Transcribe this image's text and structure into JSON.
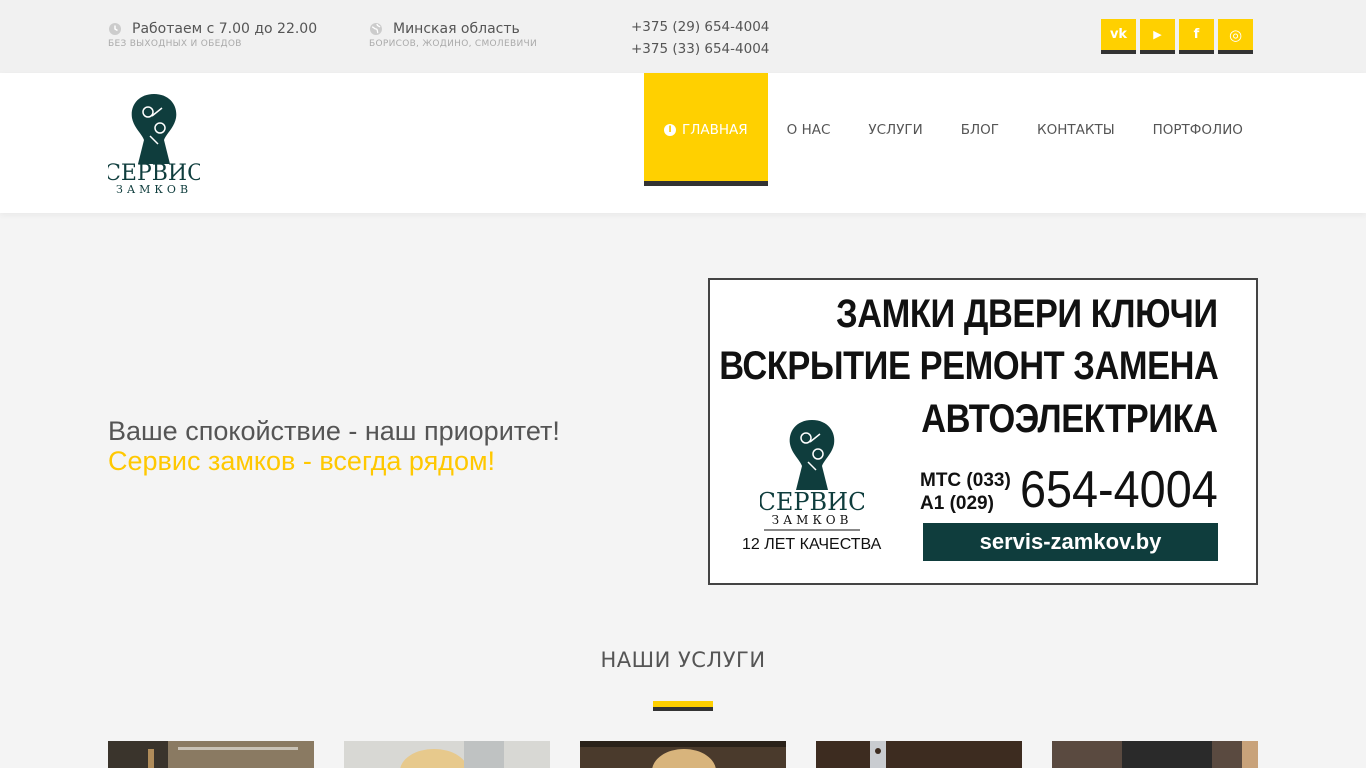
{
  "topbar": {
    "hours": {
      "main": "Работаем с 7.00 до 22.00",
      "sub": "БЕЗ ВЫХОДНЫХ И ОБЕДОВ",
      "icon": "clock-icon"
    },
    "region": {
      "main": "Минская область",
      "sub": "БОРИСОВ, ЖОДИНО, СМОЛЕВИЧИ",
      "icon": "globe-icon"
    },
    "phones": [
      "+375 (29) 654-4004",
      "+375 (33) 654-4004"
    ],
    "social": [
      {
        "name": "vk-icon",
        "glyph": "vk"
      },
      {
        "name": "youtube-icon",
        "glyph": "▶"
      },
      {
        "name": "facebook-icon",
        "glyph": "f"
      },
      {
        "name": "instagram-icon",
        "glyph": "◎"
      }
    ]
  },
  "header": {
    "logo": {
      "line1": "СЕРВИС",
      "line2": "ЗАМКОВ"
    },
    "nav": [
      {
        "label": "ГЛАВНАЯ",
        "active": true
      },
      {
        "label": "О НАС"
      },
      {
        "label": "УСЛУГИ"
      },
      {
        "label": "БЛОГ"
      },
      {
        "label": "КОНТАКТЫ"
      },
      {
        "label": "ПОРТФОЛИО"
      }
    ]
  },
  "hero": {
    "line1": "Ваше спокойствие - наш приоритет!",
    "line2": "Сервис замков - всегда рядом!"
  },
  "banner": {
    "l1": "ЗАМКИ ДВЕРИ КЛЮЧИ",
    "l2": "ВСКРЫТИЕ РЕМОНТ ЗАМЕНА",
    "l3": "АВТОЭЛЕКТРИКА",
    "op1": "МТС (033)",
    "op2": "А1  (029)",
    "number": "654-4004",
    "site": "servis-zamkov.by",
    "years": "12 ЛЕТ КАЧЕСТВА",
    "logo1": "СЕРВИС",
    "logo2": "ЗАМКОВ"
  },
  "services": {
    "title": "НАШИ УСЛУГИ"
  },
  "colors": {
    "accent": "#ffd000",
    "dark": "#333333",
    "brand": "#0f3d3d"
  }
}
